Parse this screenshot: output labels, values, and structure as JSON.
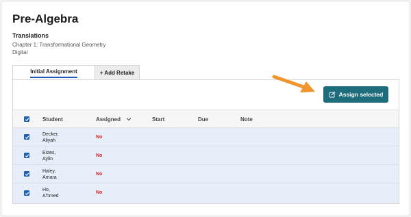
{
  "page": {
    "title": "Pre-Algebra"
  },
  "lesson": {
    "title": "Translations",
    "chapter": "Chapter 1: Transformational Geometry",
    "format": "Digital"
  },
  "tabs": [
    {
      "label": "Initial Assignment",
      "active": true
    },
    {
      "label": "+ Add Retake",
      "active": false
    }
  ],
  "assign_button": {
    "label": "Assign selected",
    "icon": "edit-icon",
    "color": "#1d6d7c"
  },
  "annotation": {
    "icon": "arrow-icon",
    "color": "#f0962e"
  },
  "table": {
    "headers": {
      "student": "Student",
      "assigned": "Assigned",
      "start": "Start",
      "due": "Due",
      "note": "Note"
    },
    "rows": [
      {
        "last": "Decker,",
        "first": "Aliyah",
        "assigned": "No",
        "checked": true
      },
      {
        "last": "Estes,",
        "first": "Aylin",
        "assigned": "No",
        "checked": true
      },
      {
        "last": "Haley,",
        "first": "Amara",
        "assigned": "No",
        "checked": true
      },
      {
        "last": "Ho,",
        "first": "A'hmed",
        "assigned": "No",
        "checked": true
      }
    ]
  },
  "colors": {
    "accent": "#1a5fb4",
    "row_highlight": "#e8eef9",
    "status_no": "#d32222"
  }
}
